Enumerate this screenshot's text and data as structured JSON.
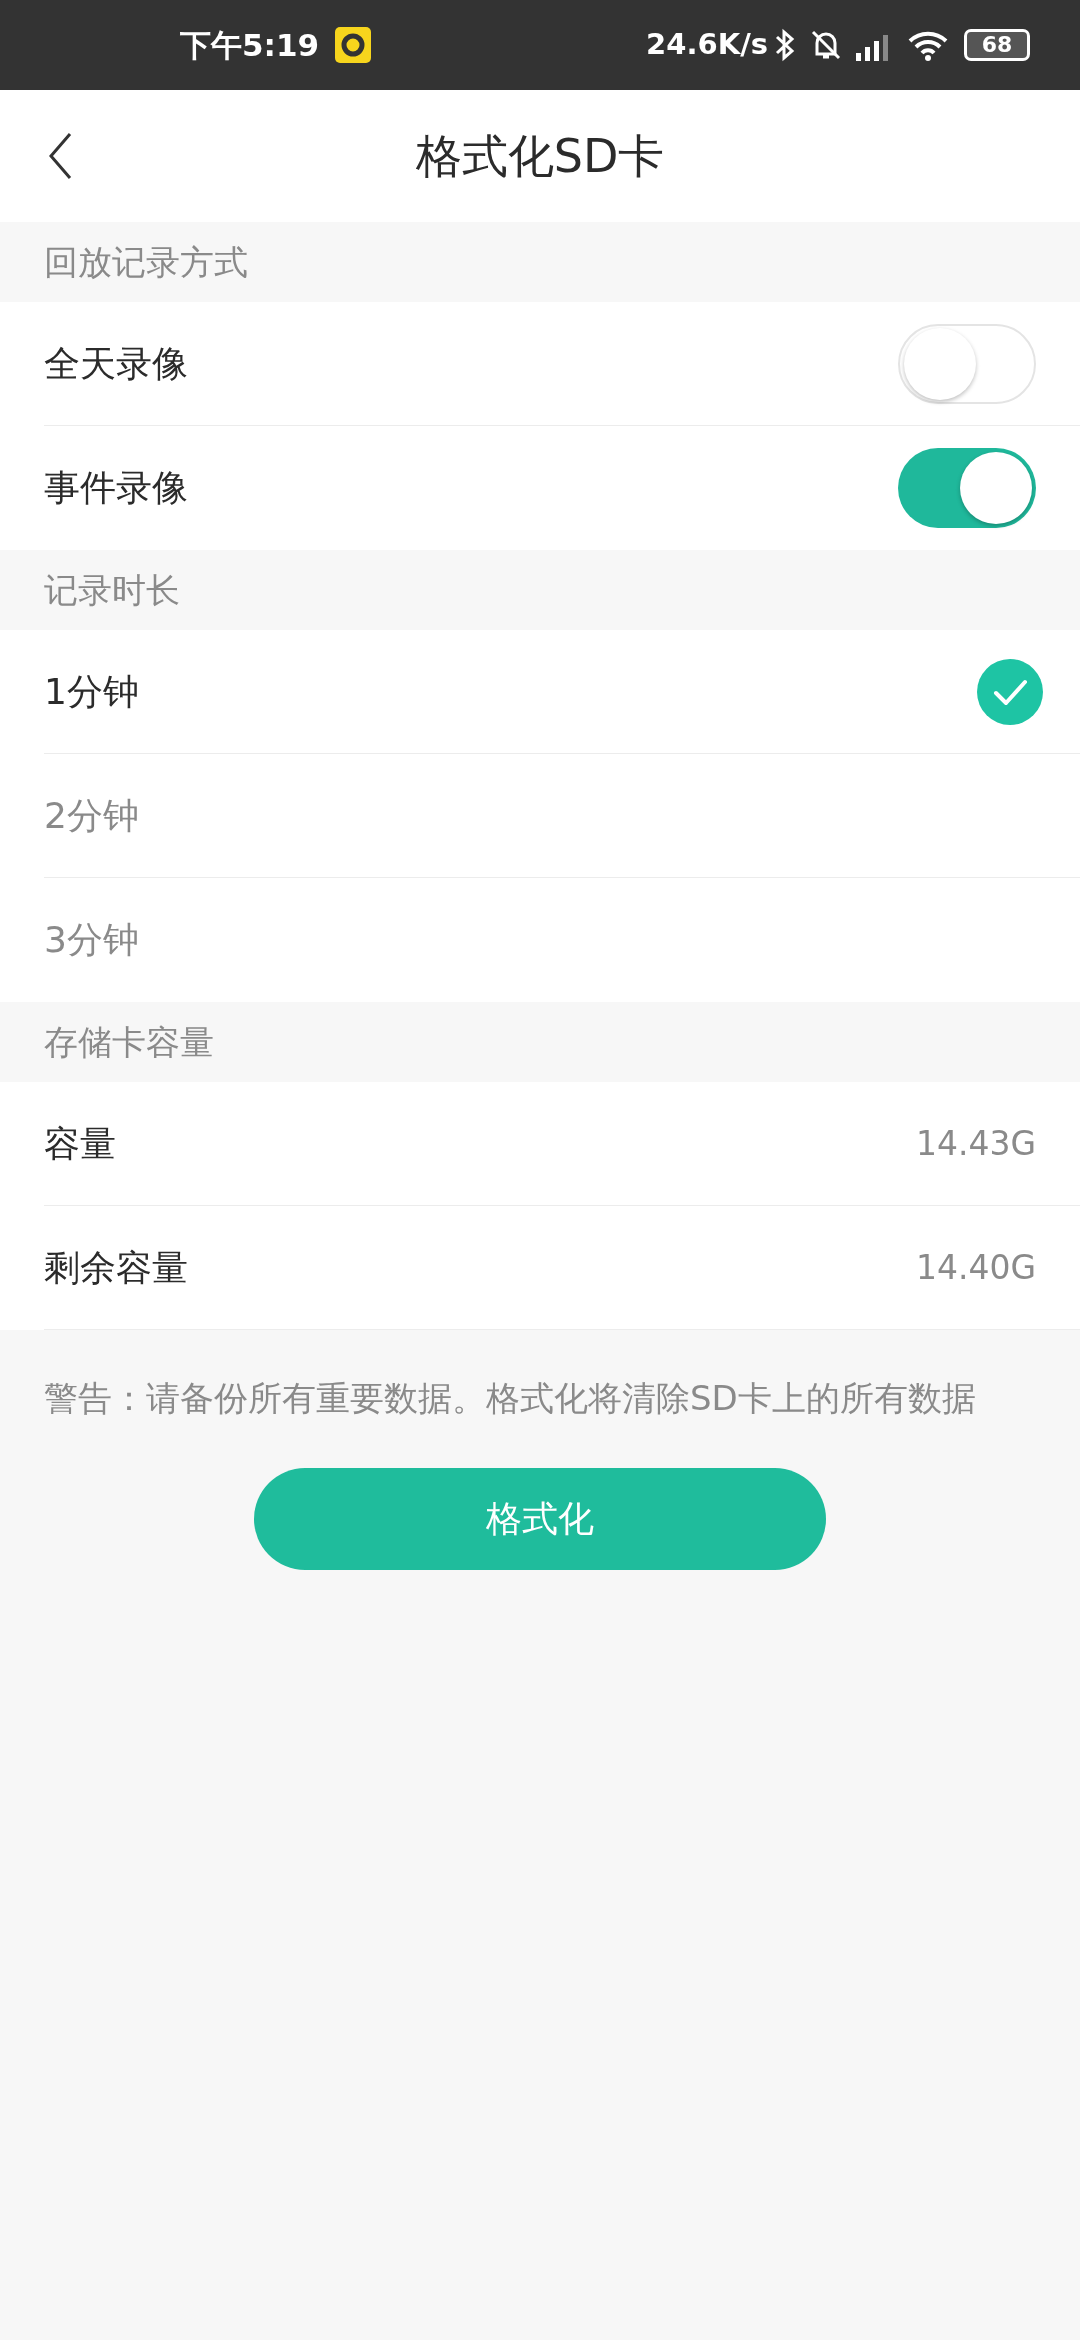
{
  "status_bar": {
    "time": "下午5:19",
    "speed": "24.6K/s",
    "battery": "68"
  },
  "header": {
    "title": "格式化SD卡"
  },
  "sections": [
    {
      "title": "回放记录方式",
      "rows": [
        {
          "kind": "toggle",
          "label": "全天录像",
          "on": false
        },
        {
          "kind": "toggle",
          "label": "事件录像",
          "on": true
        }
      ]
    },
    {
      "title": "记录时长",
      "rows": [
        {
          "kind": "choice",
          "label": "1分钟",
          "selected": true
        },
        {
          "kind": "choice",
          "label": "2分钟",
          "selected": false
        },
        {
          "kind": "choice",
          "label": "3分钟",
          "selected": false
        }
      ]
    },
    {
      "title": "存储卡容量",
      "rows": [
        {
          "kind": "value",
          "label": "容量",
          "value": "14.43G"
        },
        {
          "kind": "value",
          "label": "剩余容量",
          "value": "14.40G"
        }
      ]
    }
  ],
  "warning": "警告：请备份所有重要数据。格式化将清除SD卡上的所有数据",
  "button": "格式化"
}
